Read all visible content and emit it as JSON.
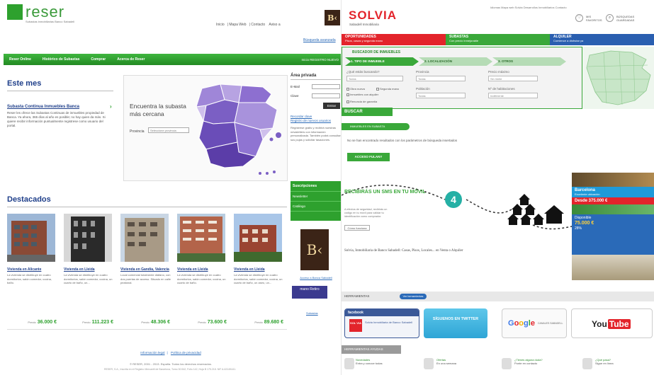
{
  "reser": {
    "logo_text": "reser",
    "tagline": "Subastas inmobiliarias Banco Sabadell",
    "top_links": [
      "Inicio",
      "Mapa Web",
      "Contacto",
      "Aviso a"
    ],
    "top_right_link": "Búsqueda avanzada",
    "nav": [
      "Reser Online",
      "Histórico de Subastas",
      "Comprar",
      "Acerca de Reser"
    ],
    "nav_right": "Inicio   REGISTRO NUEVO",
    "este_mes_title": "Este mes",
    "subasta": {
      "title": "Subasta Continua Inmuebles Banca",
      "desc": "Reser les ofrece las Subastas Continuas de inmuebles propiedad de Banca. Ya ahora, 365 días al año es posible; no hay quien da más. Si quiere recibir información puntualmente registrese como usuario del portal."
    },
    "map": {
      "headline": "Encuentra la subasta más cercana",
      "provincia_label": "Provincia",
      "provincia_placeholder": "Seleccione provincia"
    },
    "area_privada": {
      "title": "Área privada",
      "email_label": "E-Mail",
      "clave_label": "Clave",
      "entrar": "Entrar",
      "recordar": "Recordar clave",
      "registro": "Registro de nuevos usuarios",
      "text": "Regístrese gratis y recibirá nuestras newsletters con información personalizada. También podrá consultar sus pujas y solicitar tasaciones."
    },
    "suscripciones": [
      "Suscripciones",
      "Newsletter",
      "Catálogo"
    ],
    "bk_side_link": "Acceso a Banca Sabadell",
    "mano_text": "mano Retiro",
    "mano_link": "Subastas",
    "destacados_title": "Destacados",
    "price_label": "Precio",
    "cards": [
      {
        "title": "Vivienda en Alicante",
        "desc": "La vivienda se distribuye en cuatro dormitorios, salón comedor, cocina, baño.",
        "price": "36.000 €"
      },
      {
        "title": "Vivienda en Lleida",
        "desc": "La vivienda se distribuye en cuatro dormitorios, salón comedor, cocina, un cuarto de baño, un...",
        "price": "111.223 €"
      },
      {
        "title": "Vivienda en Gandía, Valencia",
        "desc": "Local comercial totalmente diáfano, con dos puertas de acceso. Situado en calle peatonal.",
        "price": "48.306 €"
      },
      {
        "title": "Vivienda en Lleida",
        "desc": "La vivienda se distribuye en cuatro dormitorios, salón comedor, cocina, un cuarto de baño.",
        "price": "73.600 €"
      },
      {
        "title": "Vivienda en Lleida",
        "desc": "La vivienda se distribuye en cuatro dormitorios, salón comedor, cocina, un cuarto de baño, un aseo, un...",
        "price": "89.680 €"
      }
    ],
    "footer_links": [
      "Información legal",
      "Política de privacidad"
    ],
    "copyright": "© RESER, 2001 - 2013. España. Todos los derechos reservados.",
    "legal": "RESER, S.A., Inscrita en el Registro Mercantil de Barcelona, Tomo 30.542, Folio 142, Hoja B 175.218. NIF A-62149441."
  },
  "solvia": {
    "logo": "SOLVIA",
    "logo_sub": "Sabadell Inmobiliaria",
    "top_links": "Idiomas   Mapa web   Solvia Desarrollos Inmobiliarios   Contacto",
    "top_buttons": [
      {
        "icon": "♡",
        "label": "MIS FAVORITOS"
      },
      {
        "icon": "⌕",
        "label": "BÚSQUEDAS GUARDADAS"
      }
    ],
    "tabs": [
      {
        "label": "OPORTUNIDADES",
        "sub": "Pisos, casas y segunda mano"
      },
      {
        "label": "SUBASTAS",
        "sub": "Con precio inmejorable"
      },
      {
        "label": "ALQUILER",
        "sub": "Comience a disfrutar ya"
      }
    ],
    "buscador": {
      "title": "BUSCADOR DE INMUEBLES",
      "steps": [
        "1. TIPO DE INMUEBLE",
        "2. LOCALIZACIÓN",
        "3. OTROS"
      ],
      "fields": {
        "tipo_label": "¿Qué estás buscando?",
        "tipo_value": "Todos",
        "provincia_label": "Provincia",
        "provincia_value": "Todas",
        "precio_label": "Precio máximo",
        "precio_value": "Sin límite",
        "poblacion_label": "Población",
        "poblacion_value": "Todas",
        "hab_label": "Nº de habitaciones",
        "hab_value": "Indiferente",
        "check1": "Obra nueva",
        "check2": "Segunda mano",
        "check3": "Inmuebles con alquiler",
        "check4": "Renuncia de garantía"
      }
    },
    "buscar": "BUSCAR",
    "inmuebles_bar": "INMUEBLES EN SUBASTA",
    "no_results": "No se han encontrado resultados con los parámetros de búsqueda insertados",
    "acceso": "ACCESO FULANY",
    "sms_title": "RECIBIRÁS UN SMS EN TU MÓVIL",
    "sms_text": "A efectos de seguridad, recibirás un código en tu móvil para validar tu identificación como comprador.",
    "sms_button": "Cómo funciona",
    "step_number": "4",
    "info_line": "Solvia, Inmobiliaria de Banco Sabadell: Casas, Pisos, Locales... en Venta o Alquiler",
    "promo": {
      "banner_title": "Barcelona",
      "banner_sub": "Excelente ubicación",
      "price": "Desde 375.000 €",
      "offer_line": "Disponible",
      "offer_price": "75.000 €",
      "offer_pct": "28%"
    },
    "herramientas": "HERRAMIENTAS",
    "herramientas_pill": "Ver herramientas",
    "facebook": {
      "head": "facebook",
      "logo": "SOL VIA",
      "text": "Solvia Inmobiliaria de Banco Sabadell"
    },
    "twitter": "SÍGUENOS EN TWITTER",
    "google": {
      "logo": "Google",
      "sub": "CANALES SABADELL"
    },
    "youtube": {
      "you": "You",
      "tube": "Tube"
    },
    "ayudas": "HERRAMIENTAS AYUDAS",
    "ayuda_items": [
      {
        "title": "Novedades",
        "text": "Entra y conoce todas"
      },
      {
        "title": "Ofertas",
        "text": "En una semana"
      },
      {
        "title": "¿Tienes alguna duda?",
        "text": "Ponte en contacto"
      },
      {
        "title": "¿Qué pasa?",
        "text": "Sigue en línea"
      }
    ]
  },
  "colors": {
    "reser_green": "#2ea12e",
    "solvia_red": "#e3242b",
    "solvia_green": "#3aa83a",
    "solvia_blue": "#2a5fb0",
    "map_purple": "#7b5fc4"
  }
}
